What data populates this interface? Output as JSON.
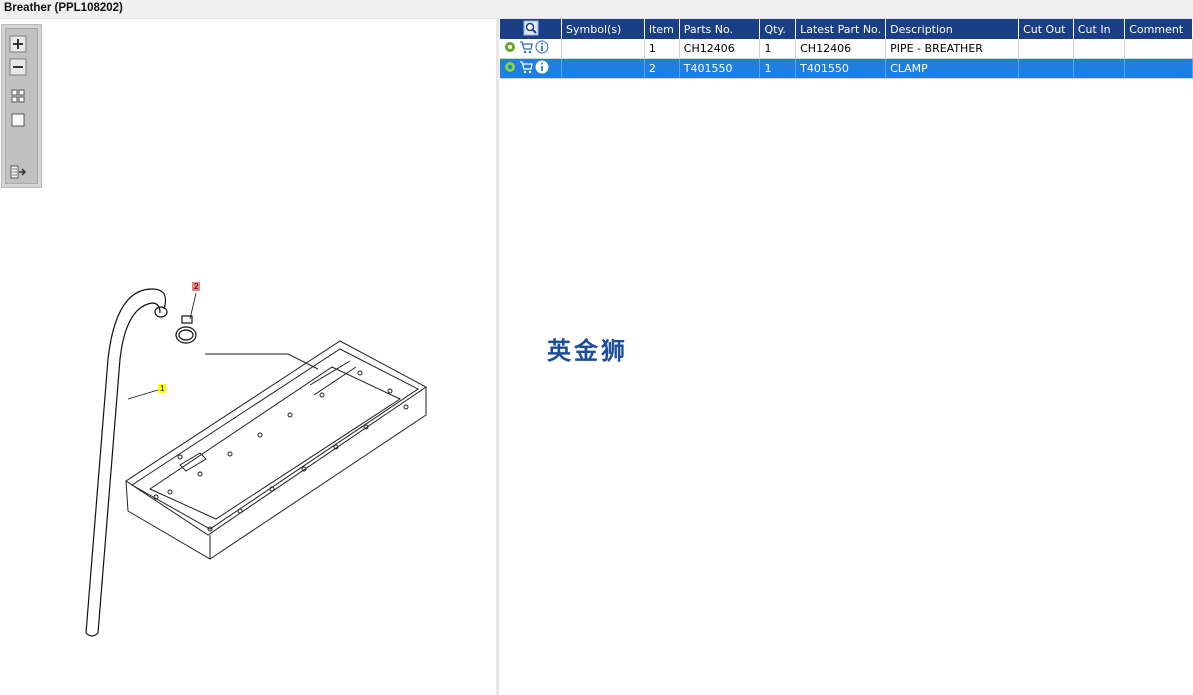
{
  "window": {
    "title": "Breather (PPL108202)"
  },
  "toolbar": {
    "buttons": [
      {
        "name": "zoom-in-icon"
      },
      {
        "name": "zoom-out-icon"
      },
      {
        "name": "fit-grid-icon"
      },
      {
        "name": "actual-size-icon"
      },
      {
        "name": "export-icon"
      }
    ]
  },
  "diagram": {
    "callouts": [
      {
        "label": "1",
        "color": "#ffff00"
      },
      {
        "label": "2",
        "color": "#f08080"
      }
    ]
  },
  "table": {
    "columns": [
      "",
      "Symbol(s)",
      "Item",
      "Parts No.",
      "Qty.",
      "Latest Part No.",
      "Description",
      "Cut Out",
      "Cut In",
      "Comment"
    ],
    "rows": [
      {
        "symbol": "",
        "item": "1",
        "part_no": "CH12406",
        "qty": "1",
        "latest_part_no": "CH12406",
        "description": "PIPE - BREATHER",
        "cut_out": "",
        "cut_in": "",
        "comment": "",
        "selected": false
      },
      {
        "symbol": "",
        "item": "2",
        "part_no": "T401550",
        "qty": "1",
        "latest_part_no": "T401550",
        "description": "CLAMP",
        "cut_out": "",
        "cut_in": "",
        "comment": "",
        "selected": true
      }
    ]
  },
  "watermark": "英金狮",
  "colors": {
    "header": "#1b3f86",
    "selection": "#1e7fe0",
    "callout_item1": "#ffff00",
    "callout_item2": "#f08080"
  }
}
